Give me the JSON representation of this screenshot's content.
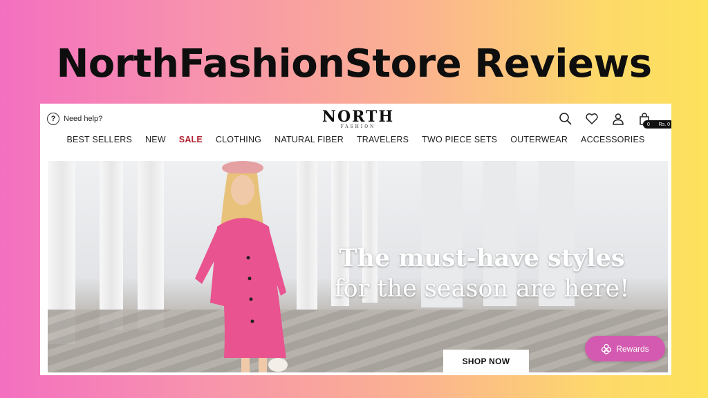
{
  "headline": "NorthFashionStore Reviews",
  "header": {
    "help_text": "Need help?",
    "logo_main": "NORTH",
    "logo_sub": "FASHION",
    "cart_count": "0",
    "cart_total": "Rs. 0"
  },
  "nav": {
    "items": [
      "BEST SELLERS",
      "NEW",
      "SALE",
      "CLOTHING",
      "NATURAL FIBER",
      "TRAVELERS",
      "TWO PIECE SETS",
      "OUTERWEAR",
      "ACCESSORIES"
    ]
  },
  "hero": {
    "line1": "The must-have styles",
    "line2": "for the season are here!",
    "cta": "SHOP NOW"
  },
  "rewards_label": "Rewards",
  "icons": [
    "help-icon",
    "search-icon",
    "heart-icon",
    "account-icon",
    "cart-icon",
    "rewards-icon"
  ],
  "colors": {
    "sale": "#b0222f",
    "rewards": "#d35ab0"
  }
}
